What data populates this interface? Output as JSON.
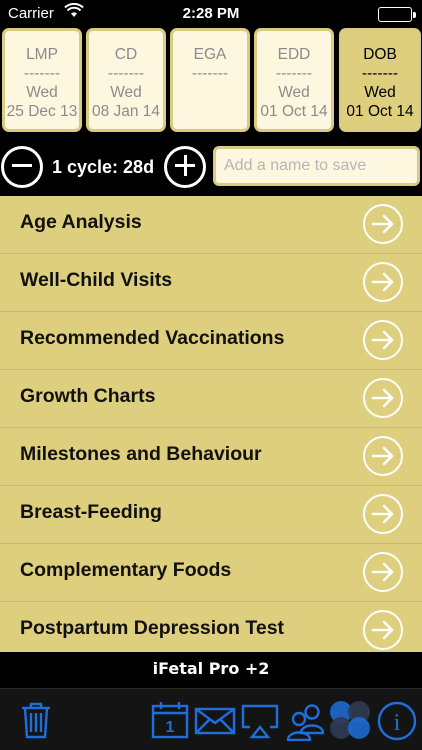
{
  "status_bar": {
    "carrier": "Carrier",
    "time": "2:28 PM"
  },
  "cards": [
    {
      "label": "LMP",
      "dash": "-------",
      "day": "Wed",
      "date": "25 Dec 13",
      "selected": false
    },
    {
      "label": "CD",
      "dash": "-------",
      "day": "Wed",
      "date": "08 Jan 14",
      "selected": false
    },
    {
      "label": "EGA",
      "dash": "-------",
      "day": "",
      "date": "",
      "selected": false
    },
    {
      "label": "EDD",
      "dash": "-------",
      "day": "Wed",
      "date": "01 Oct 14",
      "selected": false
    },
    {
      "label": "DOB",
      "dash": "-------",
      "day": "Wed",
      "date": "01 Oct 14",
      "selected": true
    }
  ],
  "cycle": {
    "text": "1 cycle: 28d"
  },
  "name_field": {
    "placeholder": "Add a name to save",
    "value": ""
  },
  "menu": [
    {
      "label": "Age Analysis"
    },
    {
      "label": "Well-Child Visits"
    },
    {
      "label": "Recommended Vaccinations"
    },
    {
      "label": "Growth Charts"
    },
    {
      "label": "Milestones and Behaviour"
    },
    {
      "label": "Breast-Feeding"
    },
    {
      "label": "Complementary Foods"
    },
    {
      "label": "Postpartum Depression Test"
    }
  ],
  "footer": {
    "title": "iFetal Pro +2"
  },
  "toolbar": {
    "icons": [
      "trash-icon",
      "calendar-icon",
      "mail-icon",
      "airplay-icon",
      "contacts-icon",
      "circles-icon",
      "info-icon"
    ],
    "calendar_number": "1",
    "info_glyph": "i"
  },
  "colors": {
    "accent_gold": "#ddcf7e",
    "card_bg": "#fdf7e0",
    "icon_blue": "#1e6fdc"
  }
}
